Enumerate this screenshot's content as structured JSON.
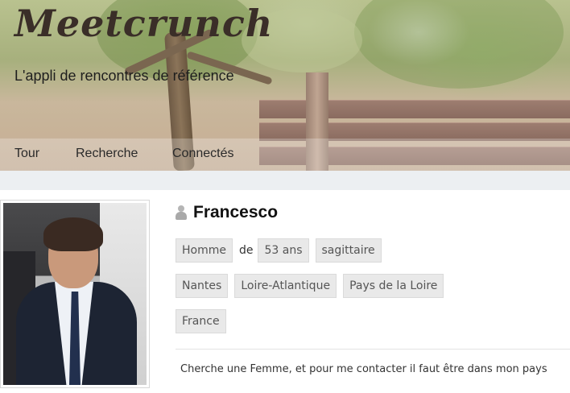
{
  "header": {
    "logo_text": "Meetcrunch",
    "tagline": "L'appli de rencontres de référence"
  },
  "nav": {
    "items": [
      {
        "label": "Tour"
      },
      {
        "label": "Recherche"
      },
      {
        "label": "Connectés"
      }
    ]
  },
  "profile": {
    "icon": "user-icon",
    "name": "Francesco",
    "gender": "Homme",
    "joiner": "de",
    "age": "53 ans",
    "zodiac": "sagittaire",
    "city": "Nantes",
    "department": "Loire-Atlantique",
    "region": "Pays de la Loire",
    "country": "France",
    "description": "Cherche une Femme, et pour me contacter il faut être dans mon pays"
  },
  "colors": {
    "divider_bg": "#eceff2",
    "tag_bg": "#e9e9e9",
    "tag_text": "#555555",
    "name_text": "#111111"
  }
}
